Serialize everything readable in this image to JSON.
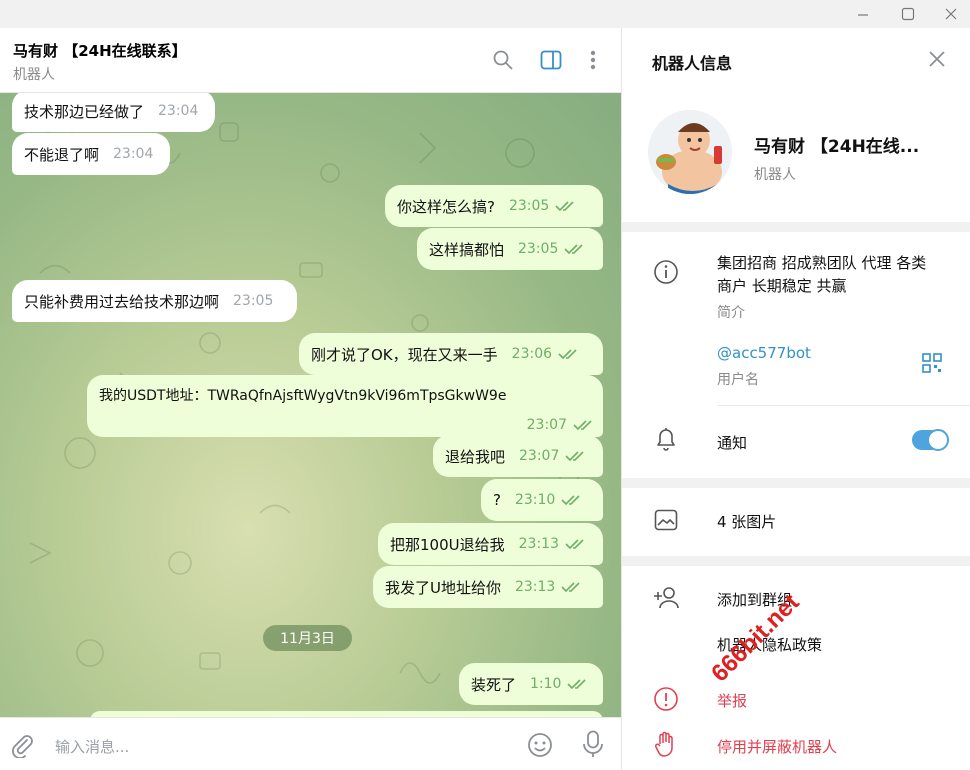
{
  "window": {
    "minimize_icon": "minimize-icon",
    "maximize_icon": "maximize-icon",
    "close_icon": "close-icon"
  },
  "chat_header": {
    "title": "马有财 【24H在线联系】",
    "subtitle": "机器人"
  },
  "messages": [
    {
      "direction": "in",
      "text": "技术那边已经做了",
      "time": "23:04"
    },
    {
      "direction": "in",
      "text": "不能退了啊",
      "time": "23:04"
    },
    {
      "direction": "out",
      "text": "你这样怎么搞?",
      "time": "23:05",
      "read": true
    },
    {
      "direction": "out",
      "text": "这样搞都怕",
      "time": "23:05",
      "read": true
    },
    {
      "direction": "in",
      "text": "只能补费用过去给技术那边啊",
      "time": "23:05"
    },
    {
      "direction": "out",
      "text": "刚才说了OK，现在又来一手",
      "time": "23:06",
      "read": true
    },
    {
      "direction": "out",
      "text": "我的USDT地址：TWRaQfnAjsftWygVtn9kVi96mTpsGkwW9e",
      "time": "23:07",
      "read": true
    },
    {
      "direction": "out",
      "text": "退给我吧",
      "time": "23:07",
      "read": true
    },
    {
      "direction": "out",
      "text": "?",
      "time": "23:10",
      "read": true
    },
    {
      "direction": "out",
      "text": "把那100U退给我",
      "time": "23:13",
      "read": true
    },
    {
      "direction": "out",
      "text": "我发了U地址给你",
      "time": "23:13",
      "read": true
    },
    {
      "direction": "out",
      "text": "装死了",
      "time": "1:10",
      "read": true
    }
  ],
  "date_divider": "11月3日",
  "composer": {
    "placeholder": "输入消息..."
  },
  "panel": {
    "title": "机器人信息",
    "name": "马有财 【24H在线...",
    "kind": "机器人",
    "description": "集团招商 招成熟团队 代理 各类商户 长期稳定 共赢",
    "description_label": "简介",
    "username": "@acc577bot",
    "username_label": "用户名",
    "notifications_label": "通知",
    "notifications_on": true,
    "photos_label": "4 张图片",
    "add_to_group": "添加到群组",
    "privacy_policy": "机器人隐私政策",
    "report": "举报",
    "block": "停用并屏蔽机器人"
  },
  "watermark": "666bit.net",
  "colors": {
    "accent": "#3390c8",
    "outgoing_bubble": "#eefed9",
    "danger": "#e04050",
    "watermark": "#e02020"
  }
}
